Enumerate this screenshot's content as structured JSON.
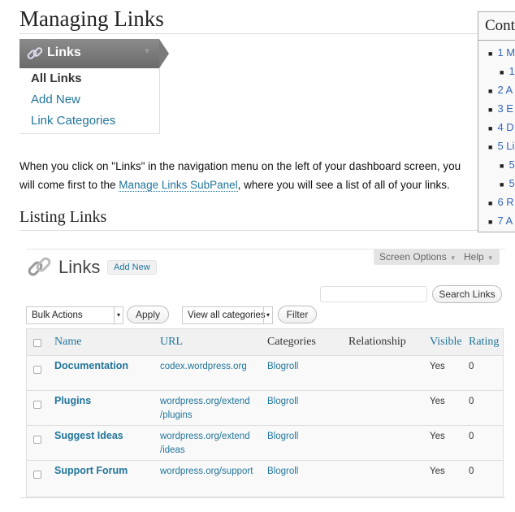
{
  "page": {
    "title": "Managing Links",
    "intro_before": "When you click on \"Links\" in the navigation menu on the left of your dashboard screen, you will come first to the ",
    "intro_link": "Manage Links SubPanel",
    "intro_after": ", where you will see a list of all of your links.",
    "section_title": "Listing Links"
  },
  "toc": {
    "title": "Cont",
    "items": [
      "1 M",
      "1",
      "2 A",
      "3 E",
      "4 D",
      "5 Li",
      "5",
      "5",
      "6 R",
      "7 A"
    ]
  },
  "links_menu": {
    "label": "Links",
    "items": [
      "All Links",
      "Add New",
      "Link Categories"
    ]
  },
  "panel": {
    "title": "Links",
    "add_new": "Add New",
    "screen_options": "Screen Options",
    "help": "Help",
    "search_placeholder": "",
    "search_button": "Search Links",
    "bulk_actions": "Bulk Actions",
    "apply": "Apply",
    "categories_select": "View all categories",
    "filter": "Filter",
    "columns": [
      "Name",
      "URL",
      "Categories",
      "Relationship",
      "Visible",
      "Rating"
    ],
    "rows": [
      {
        "name": "Documentation",
        "url1": "codex.wordpress.org",
        "url2": "",
        "category": "Blogroll",
        "relationship": "",
        "visible": "Yes",
        "rating": "0"
      },
      {
        "name": "Plugins",
        "url1": "wordpress.org/extend",
        "url2": "/plugins",
        "category": "Blogroll",
        "relationship": "",
        "visible": "Yes",
        "rating": "0"
      },
      {
        "name": "Suggest Ideas",
        "url1": "wordpress.org/extend",
        "url2": "/ideas",
        "category": "Blogroll",
        "relationship": "",
        "visible": "Yes",
        "rating": "0"
      },
      {
        "name": "Support Forum",
        "url1": "wordpress.org/support",
        "url2": "",
        "category": "Blogroll",
        "relationship": "",
        "visible": "Yes",
        "rating": "0"
      }
    ]
  }
}
